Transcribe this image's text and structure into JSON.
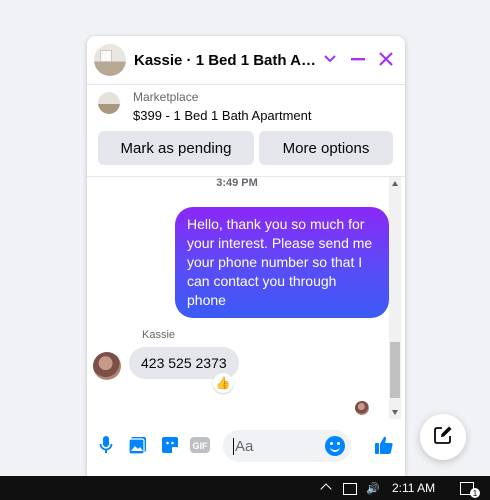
{
  "header": {
    "title": "Kassie · 1 Bed 1 Bath Apart…",
    "icons": [
      "chevron-down-icon",
      "minimize-icon",
      "close-icon"
    ],
    "accent_color": "#a033ff"
  },
  "listing": {
    "section_label": "Marketplace",
    "item": "$399 - 1 Bed 1 Bath Apartment",
    "buttons": {
      "mark_pending": "Mark as pending",
      "more_options": "More options"
    }
  },
  "thread": {
    "timestamp": "3:49 PM",
    "messages": [
      {
        "direction": "outgoing",
        "text": "Hello, thank you so much for your interest. Please send me your phone number so that I can contact you through phone"
      },
      {
        "direction": "incoming",
        "sender": "Kassie",
        "text": "423 525 2373",
        "reaction": "👍"
      }
    ]
  },
  "composer": {
    "placeholder": "Aa",
    "icons": [
      "microphone-icon",
      "photo-icon",
      "sticker-icon",
      "gif-icon",
      "emoji-icon",
      "thumbs-up-icon"
    ],
    "gif_label": "GIF"
  },
  "new_message_button": {
    "icon": "compose-icon"
  },
  "taskbar": {
    "time": "2:11 AM",
    "notification_count": "1"
  }
}
